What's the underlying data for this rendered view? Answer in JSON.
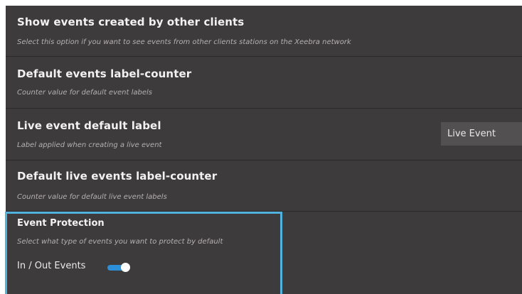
{
  "settings": [
    {
      "title": "Show events created by other clients",
      "description": "Select this option if you want to see events from other clients stations on the Xeebra network"
    },
    {
      "title": "Default events label-counter",
      "description": "Counter value for default event labels"
    },
    {
      "title": "Live event default label",
      "description": "Label applied when creating a live event",
      "value": "Live Event"
    },
    {
      "title": "Default live events label-counter",
      "description": "Counter value for default live event labels"
    }
  ],
  "event_protection": {
    "title": "Event Protection",
    "description": "Select what type of events you want to protect by default",
    "toggle_label": "In / Out Events",
    "toggle_on": true
  },
  "colors": {
    "background": "#3e3b3c",
    "highlight_border": "#53b1de",
    "toggle_track": "#2d8fd8"
  }
}
